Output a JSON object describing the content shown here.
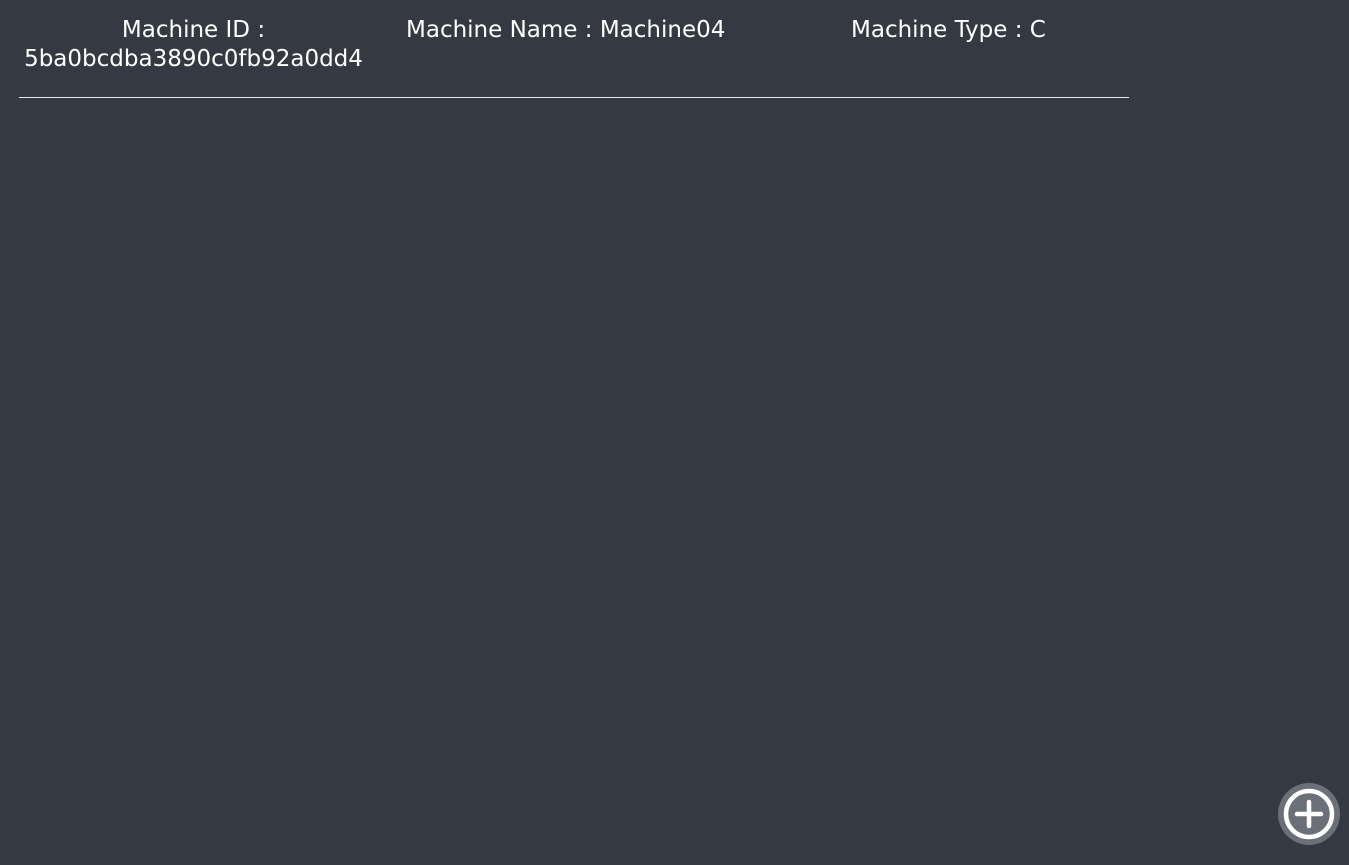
{
  "machine": {
    "id_label": "Machine ID :",
    "id_value": "5ba0bcdba3890c0fb92a0dd4",
    "name_label": "Machine Name :",
    "name_value": "Machine04",
    "type_label": "Machine Type :",
    "type_value": "C"
  },
  "fab": {
    "icon": "plus-circle-icon",
    "icon_color": "#ffffff",
    "background": "#6b6f77"
  },
  "colors": {
    "background": "#353942",
    "text": "#ffffff",
    "divider": "#e6e6e6"
  }
}
